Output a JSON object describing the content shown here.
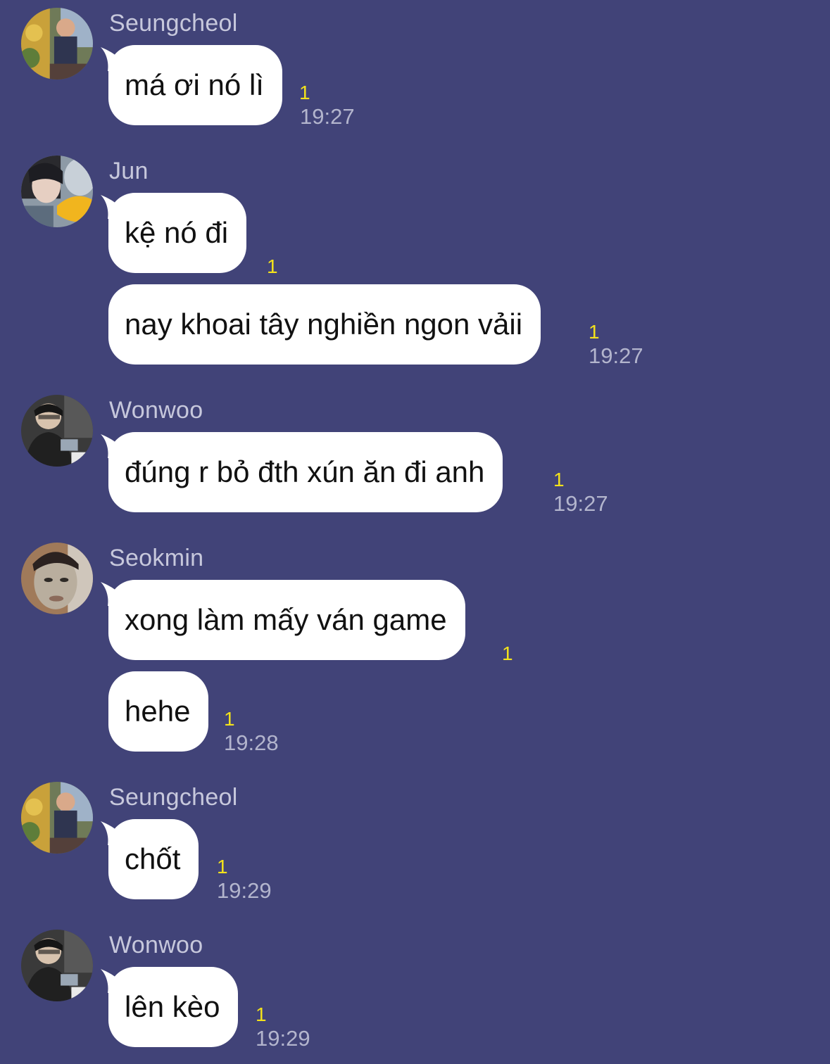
{
  "colors": {
    "background": "#414378",
    "bubble": "#ffffff",
    "sender_name": "#c7c8dc",
    "unread_count": "#f3e21b",
    "timestamp": "#b3b5cd"
  },
  "messages": [
    {
      "sender": "Seungcheol",
      "avatar": "seungcheol-avatar",
      "text": "má ơi nó lì",
      "unread": "1",
      "time": "19:27"
    },
    {
      "sender": "Jun",
      "avatar": "jun-avatar",
      "text": "kệ nó đi",
      "unread": "1"
    },
    {
      "text": "nay khoai tây nghiền ngon vảii",
      "unread": "1",
      "time": "19:27"
    },
    {
      "sender": "Wonwoo",
      "avatar": "wonwoo-avatar",
      "text": "đúng r bỏ đth xún ăn đi anh",
      "unread": "1",
      "time": "19:27"
    },
    {
      "sender": "Seokmin",
      "avatar": "seokmin-avatar",
      "text": "xong làm mấy ván game",
      "unread": "1"
    },
    {
      "text": "hehe",
      "unread": "1",
      "time": "19:28"
    },
    {
      "sender": "Seungcheol",
      "avatar": "seungcheol-avatar",
      "text": "chốt",
      "unread": "1",
      "time": "19:29"
    },
    {
      "sender": "Wonwoo",
      "avatar": "wonwoo-avatar",
      "text": "lên kèo",
      "unread": "1",
      "time": "19:29"
    }
  ]
}
